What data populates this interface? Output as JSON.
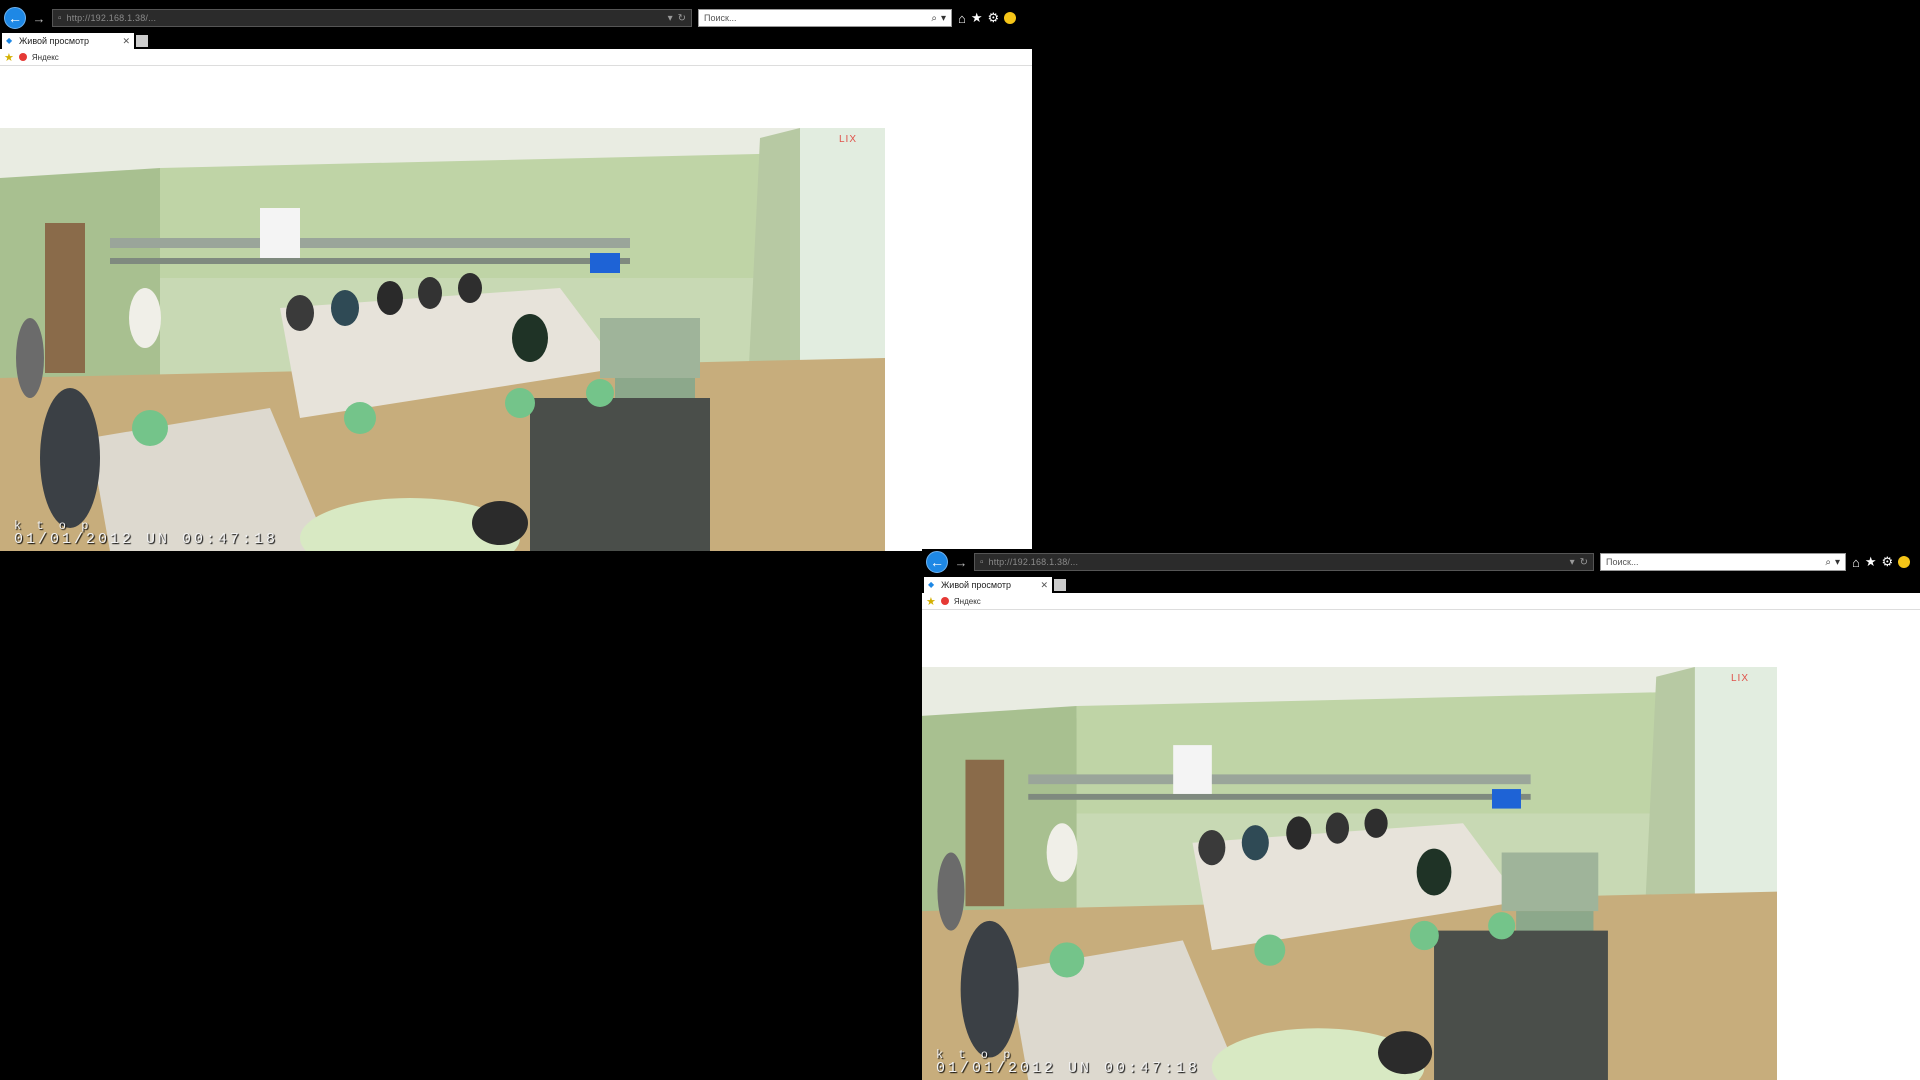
{
  "browser": {
    "url": "http://192.168.1.38/...",
    "search_placeholder": "Поиск...",
    "tab_title": "Живой просмотр",
    "favorites": [
      "Яндекс"
    ]
  },
  "camera": {
    "device_name": "k t o p",
    "timestamp": "01/01/2012  UN  00:47:18",
    "corner_label": "LIX"
  },
  "icons": [
    "back-arrow-icon",
    "forward-arrow-icon",
    "refresh-icon",
    "search-icon",
    "home-icon",
    "star-icon",
    "gear-icon",
    "smiley-icon"
  ]
}
